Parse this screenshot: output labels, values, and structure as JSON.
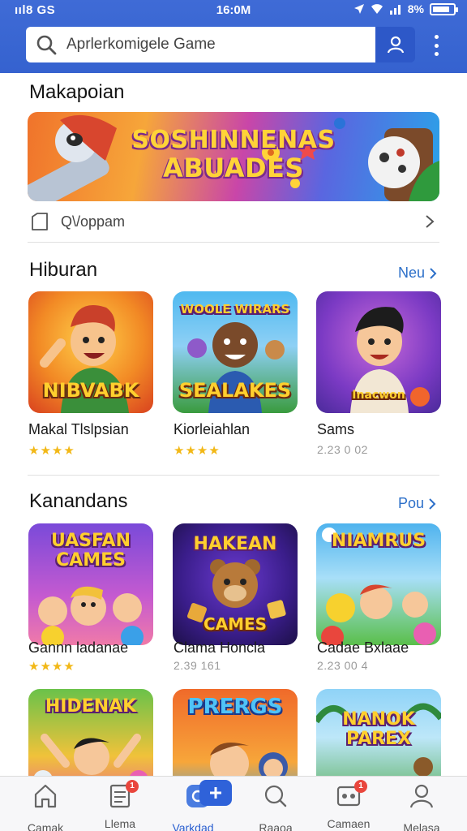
{
  "status_bar": {
    "left": "ııl8 GS",
    "time": "16:0M",
    "battery": "8%",
    "battery_level": 0.85
  },
  "search": {
    "placeholder": "Aprlerkomigele Game"
  },
  "sections": {
    "featured": {
      "title": "Makapoian",
      "banner_line1": "SOSHINNENAS",
      "banner_line2": "ABUADES",
      "shop_label": "Q\\/oppam"
    },
    "entertainment": {
      "title": "Hiburan",
      "see_all": "Neu"
    },
    "categories": {
      "title": "Kanandans",
      "see_all": "Pou"
    }
  },
  "row1": [
    {
      "name": "Makal Tlslpsian",
      "art_text": "NIBVABK",
      "rating_stars": "★★★★",
      "meta": ""
    },
    {
      "name": "Kiorleiahlan",
      "art_text": "SEALAKES",
      "art_top": "WOOLE WIRARS",
      "rating_stars": "★★★★",
      "meta": ""
    },
    {
      "name": "Sams",
      "art_text": "Inacwon",
      "rating_stars": "",
      "meta": "2.23 0 02"
    }
  ],
  "row2": [
    {
      "name": "Gannn ladanae",
      "art_top": "UASFAN CAMES",
      "rating_stars": "★★★★",
      "meta": ""
    },
    {
      "name": "Clama Honcla",
      "art_top": "HAKEAN",
      "art_text": "CAMES",
      "rating_stars": "",
      "meta": "2.39 161"
    },
    {
      "name": "Cadae Bxlaae",
      "art_top": "NIAMRUS",
      "rating_stars": "",
      "meta": "2.23 00 4"
    }
  ],
  "row3": [
    {
      "art_top": "HIDENAK"
    },
    {
      "art_top": "PRERGS"
    },
    {
      "art_top": "NANOK PAREX"
    }
  ],
  "bottom_nav": [
    {
      "label": "Camak",
      "icon": "home-icon"
    },
    {
      "label": "Llema",
      "icon": "news-icon",
      "badge": "1"
    },
    {
      "label": "Varkdad",
      "icon": "discover-icon"
    },
    {
      "label": "Raaoa",
      "icon": "search-icon"
    },
    {
      "label": "Camaen",
      "icon": "apps-icon",
      "badge": "1"
    },
    {
      "label": "Melasa",
      "icon": "profile-icon"
    }
  ],
  "colors": {
    "header": "#3562cf",
    "accent": "#2c6fc9",
    "star": "#f2b817",
    "badge": "#e9463d"
  }
}
